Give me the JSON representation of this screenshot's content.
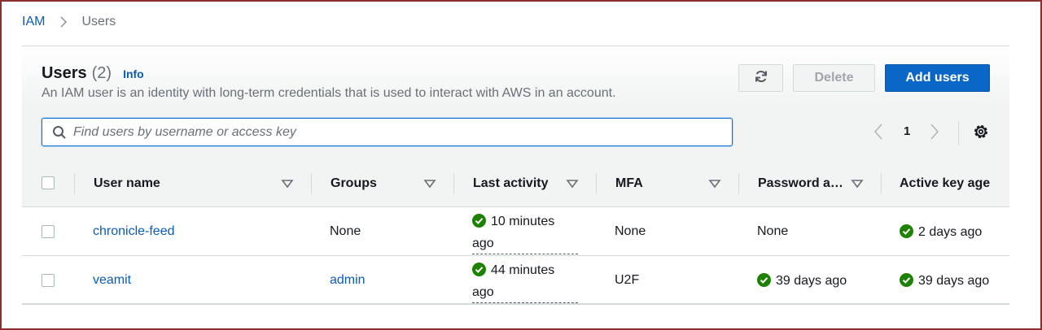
{
  "breadcrumb": {
    "root": "IAM",
    "current": "Users"
  },
  "header": {
    "title": "Users",
    "count": "(2)",
    "info": "Info",
    "description": "An IAM user is an identity with long-term credentials that is used to interact with AWS in an account."
  },
  "actions": {
    "refresh_icon": "refresh-icon",
    "delete": "Delete",
    "add": "Add users"
  },
  "search": {
    "placeholder": "Find users by username or access key",
    "value": ""
  },
  "pagination": {
    "page": "1"
  },
  "columns": [
    "User name",
    "Groups",
    "Last activity",
    "MFA",
    "Password a…",
    "Active key age"
  ],
  "rows": [
    {
      "user": "chronicle-feed",
      "groups": "None",
      "activity_line1": "10 minutes",
      "activity_line2": "ago",
      "mfa": "None",
      "password_age": "None",
      "key_age": "2 days ago"
    },
    {
      "user": "veamit",
      "groups": "admin",
      "activity_line1": "44 minutes",
      "activity_line2": "ago",
      "mfa": "U2F",
      "password_age": "39 days ago",
      "key_age": "39 days ago"
    }
  ],
  "colors": {
    "link": "#0a5cb8",
    "primary": "#0a67c7",
    "success": "#1d8102",
    "frame": "#8b2e2e"
  }
}
